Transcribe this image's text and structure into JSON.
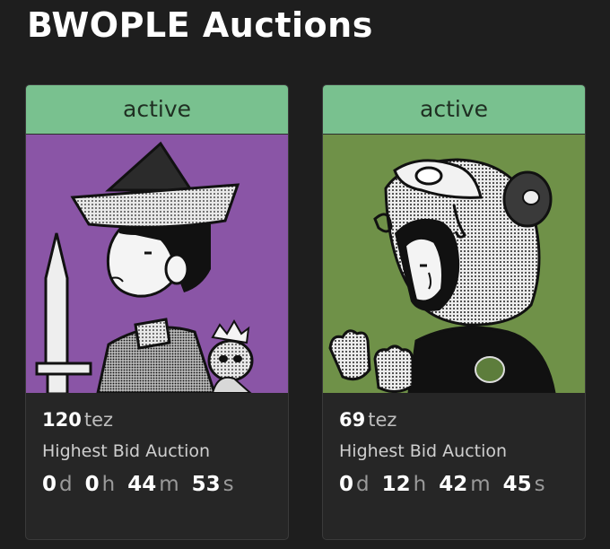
{
  "page": {
    "title": "BWOPLE Auctions"
  },
  "colors": {
    "background": "#1e1e1e",
    "card": "#262626",
    "status_green": "#79c18f",
    "art_bg_1": "#8a55a6",
    "art_bg_2": "#6f9148"
  },
  "auctions": [
    {
      "status": "active",
      "price": "120",
      "currency": "tez",
      "auction_type": "Highest Bid Auction",
      "countdown": {
        "d": "0",
        "h": "0",
        "m": "44",
        "s": "53"
      },
      "units": {
        "d": "d",
        "h": "h",
        "m": "m",
        "s": "s"
      }
    },
    {
      "status": "active",
      "price": "69",
      "currency": "tez",
      "auction_type": "Highest Bid Auction",
      "countdown": {
        "d": "0",
        "h": "12",
        "m": "42",
        "s": "45"
      },
      "units": {
        "d": "d",
        "h": "h",
        "m": "m",
        "s": "s"
      }
    }
  ]
}
